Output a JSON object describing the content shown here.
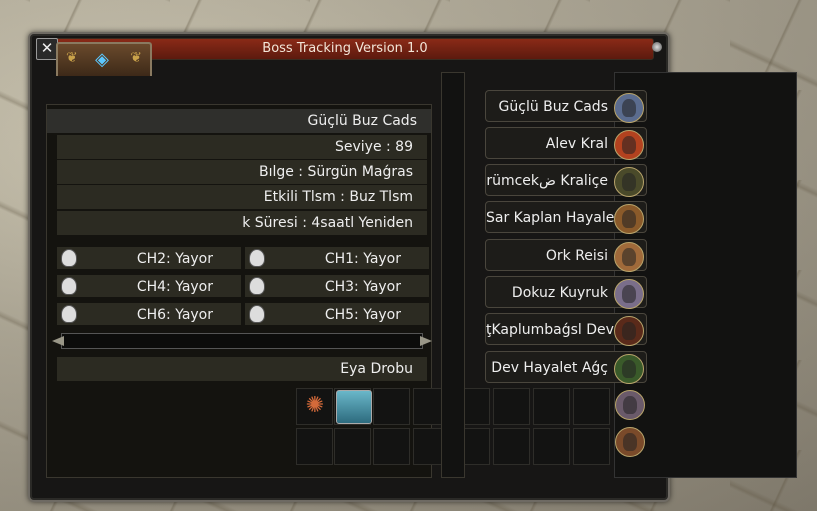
{
  "window": {
    "title": "Boss Tracking Version 1.0",
    "close_label": "✕"
  },
  "details": {
    "boss_name": "Güçlü Buz Cads",
    "level": "Seviye : 89",
    "region": "Bılge : Sürgün Maǵras",
    "effective_stone": "Etkili Tlsm : Buz Tlsm",
    "respawn": "k Süresi : 4saatl Yeniden",
    "drops_label": "Eya Drobu"
  },
  "channels": [
    {
      "label": "CH2: Yayor"
    },
    {
      "label": "CH1: Yayor"
    },
    {
      "label": "CH4: Yayor"
    },
    {
      "label": "CH3: Yayor"
    },
    {
      "label": "CH6: Yayor"
    },
    {
      "label": "CH5: Yayor"
    }
  ],
  "bosses": [
    {
      "name": "Güçlü Buz Cads",
      "color": "#5b6c8f"
    },
    {
      "name": "Alev Kral",
      "color": "#b3421f"
    },
    {
      "name": "rümcekض Kraliçe",
      "color": "#4a4a2a"
    },
    {
      "name": "Sar Kaplan Hayaleti",
      "color": "#8a5a2a"
    },
    {
      "name": "Ork Reisi",
      "color": "#a06a3a"
    },
    {
      "name": "Dokuz Kuyruk",
      "color": "#7a6e8a"
    },
    {
      "name": "ţKaplumbaǵsl Dev",
      "color": "#5a2a1a"
    },
    {
      "name": "Dev Hayalet Aǵç",
      "color": "#3a5a2a"
    },
    {
      "name": "",
      "color": "#6a5a6a"
    },
    {
      "name": "",
      "color": "#7a4a2a"
    }
  ]
}
